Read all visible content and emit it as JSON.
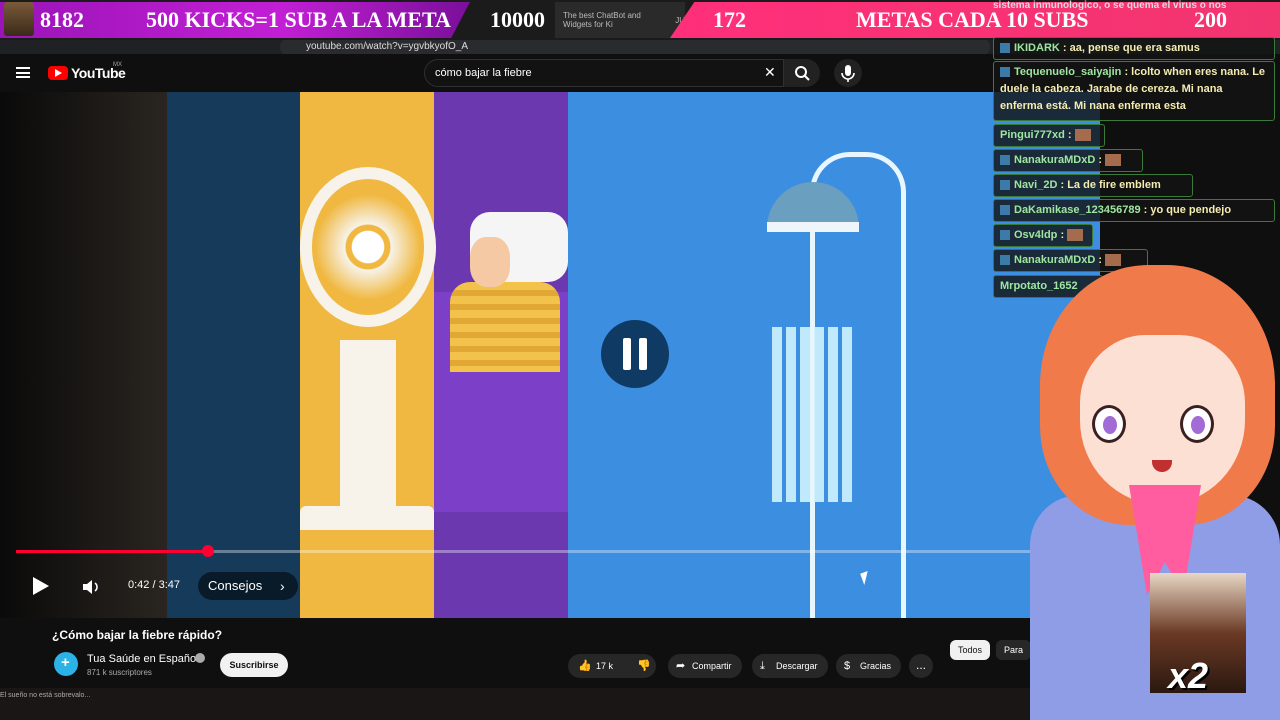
{
  "banner": {
    "left_count": "8182",
    "left_goal": "500 KICKS=1 SUB A LA META",
    "left_target": "10000",
    "right_count": "172",
    "right_goal": "METAS CADA 10 SUBS",
    "right_target": "200",
    "tab_1": "The best ChatBot and Widgets for Ki",
    "tab_2": "JU"
  },
  "browser": {
    "url": "youtube.com/watch?v=ygvbkyofO_A"
  },
  "youtube": {
    "logo_text": "YouTube",
    "region": "MX",
    "search_value": "cómo bajar la fiebre"
  },
  "player": {
    "time": "0:42 / 3:47",
    "chapter": "Consejos",
    "progress": 0.185
  },
  "video_info": {
    "title": "¿Cómo bajar la fiebre rápido?",
    "channel": "Tua Saúde en Español",
    "subscribers": "871 k suscriptores",
    "subscribe_label": "Suscribirse",
    "likes": "17 k",
    "share_label": "Compartir",
    "download_label": "Descargar",
    "thanks_label": "Gracias",
    "more_label": "...",
    "chip_all": "Todos",
    "chip_next": "Para"
  },
  "taskbar": {
    "text": "El sueño no está sobrevalo..."
  },
  "chat": {
    "top_text": "sistema inmunologico, o se quema el virus o nos",
    "messages": [
      {
        "user": "IKIDARK",
        "text": "aa, pense que era samus"
      },
      {
        "user": "Tequenuelo_saiyajin",
        "text": "lcolto when eres nana. Le duele la cabeza. Jarabe de cereza. Mi nana enferma está. Mi nana enferma esta"
      },
      {
        "user": "Pingui777xd",
        "text": ":"
      },
      {
        "user": "NanakuraMDxD",
        "text": ":"
      },
      {
        "user": "Navi_2D",
        "text": ": La de fire emblem"
      },
      {
        "user": "DaKamikase_123456789",
        "text": ": yo que pendejo"
      },
      {
        "user": "Osv4ldp",
        "text": ":"
      },
      {
        "user": "NanakuraMDxD",
        "text": ":"
      },
      {
        "user": "Mrpotato_1652",
        "text": ""
      }
    ]
  },
  "overlay": {
    "multiplier": "x2"
  },
  "colors": {
    "progress": "#ff0033",
    "banner_left": "#b51bcf",
    "banner_right": "#f2356f"
  }
}
